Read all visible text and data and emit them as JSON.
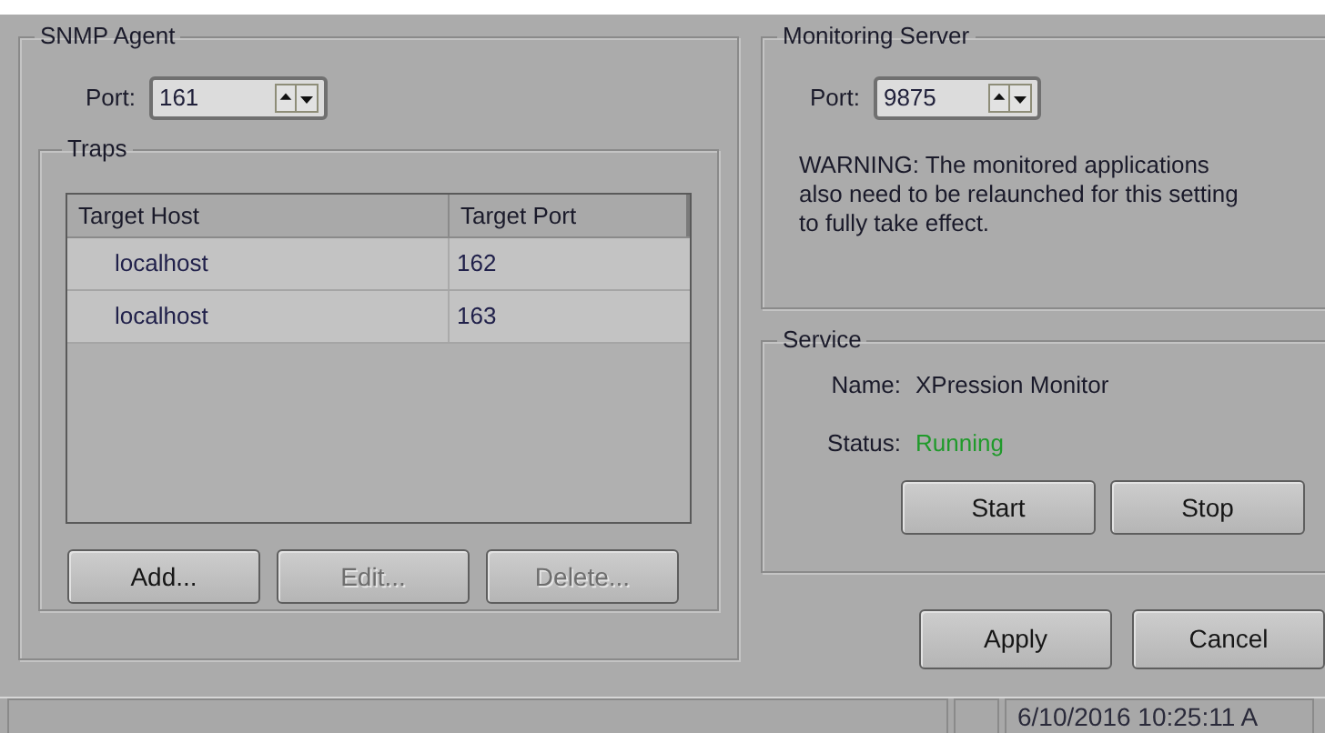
{
  "snmp_agent": {
    "title": "SNMP Agent",
    "port_label": "Port:",
    "port_value": "161",
    "traps": {
      "title": "Traps",
      "columns": [
        "Target Host",
        "Target Port"
      ],
      "rows": [
        [
          "localhost",
          "162"
        ],
        [
          "localhost",
          "163"
        ]
      ],
      "buttons": [
        {
          "label": "Add...",
          "disabled": false
        },
        {
          "label": "Edit...",
          "disabled": true
        },
        {
          "label": "Delete...",
          "disabled": true
        }
      ]
    }
  },
  "monitoring_server": {
    "title": "Monitoring Server",
    "port_label": "Port:",
    "port_value": "9875",
    "warning": "WARNING: The monitored applications also need to be relaunched for this setting to fully take effect."
  },
  "service": {
    "title": "Service",
    "name_label": "Name:",
    "name_value": "XPression Monitor",
    "status_label": "Status:",
    "status_value": "Running",
    "buttons": [
      "Start",
      "Stop"
    ]
  },
  "buttons": [
    "Apply",
    "Cancel"
  ],
  "status_bar": {
    "timestamp": "6/10/2016 10:25:11 A"
  }
}
